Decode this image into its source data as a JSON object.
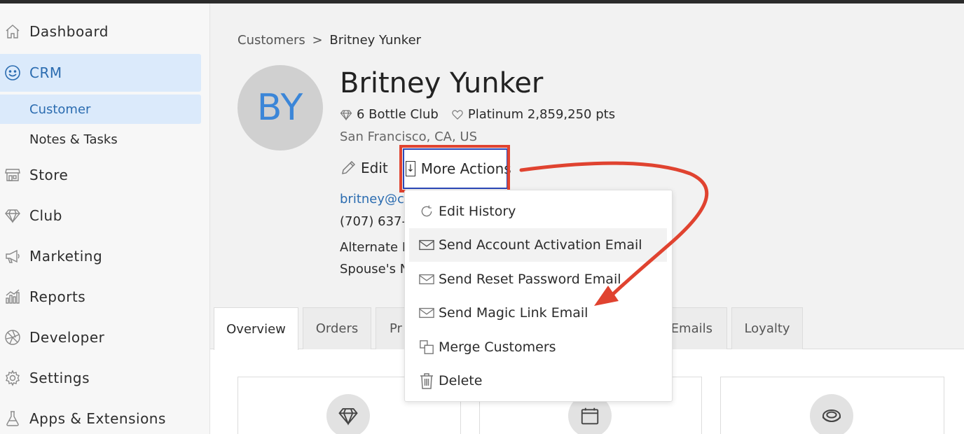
{
  "sidebar": {
    "items": [
      {
        "label": "Dashboard",
        "icon": "home-icon"
      },
      {
        "label": "CRM",
        "icon": "smiley-icon"
      },
      {
        "label": "Store",
        "icon": "storefront-icon"
      },
      {
        "label": "Club",
        "icon": "diamond-icon"
      },
      {
        "label": "Marketing",
        "icon": "megaphone-icon"
      },
      {
        "label": "Reports",
        "icon": "bar-chart-icon"
      },
      {
        "label": "Developer",
        "icon": "aperture-icon"
      },
      {
        "label": "Settings",
        "icon": "gear-icon"
      },
      {
        "label": "Apps & Extensions",
        "icon": "flask-icon"
      }
    ],
    "crm_sub": [
      {
        "label": "Customer"
      },
      {
        "label": "Notes & Tasks"
      }
    ]
  },
  "breadcrumb": {
    "parent": "Customers",
    "separator": ">",
    "current": "Britney Yunker"
  },
  "customer": {
    "initials": "BY",
    "name": "Britney Yunker",
    "club": "6 Bottle Club",
    "loyalty": "Platinum 2,859,250 pts",
    "location": "San Francisco, CA, US",
    "email": "britney@co",
    "phone": "(707) 637-",
    "alternate": "Alternate E",
    "spouse": "Spouse's N"
  },
  "actions": {
    "edit": "Edit",
    "more": "More Actions"
  },
  "dropdown": {
    "items": [
      {
        "label": "Edit History",
        "icon": "history-icon"
      },
      {
        "label": "Send Account Activation Email",
        "icon": "envelope-icon"
      },
      {
        "label": "Send Reset Password Email",
        "icon": "envelope-icon"
      },
      {
        "label": "Send Magic Link Email",
        "icon": "envelope-icon"
      },
      {
        "label": "Merge Customers",
        "icon": "merge-icon"
      },
      {
        "label": "Delete",
        "icon": "trash-icon"
      }
    ]
  },
  "tabs": [
    {
      "label": "Overview"
    },
    {
      "label": "Orders"
    },
    {
      "label": "Pr"
    },
    {
      "label": "Emails"
    },
    {
      "label": "Loyalty"
    }
  ],
  "colors": {
    "accent": "#2b6cb0",
    "highlight": "#e04330",
    "active_bg": "#dbeafb"
  }
}
